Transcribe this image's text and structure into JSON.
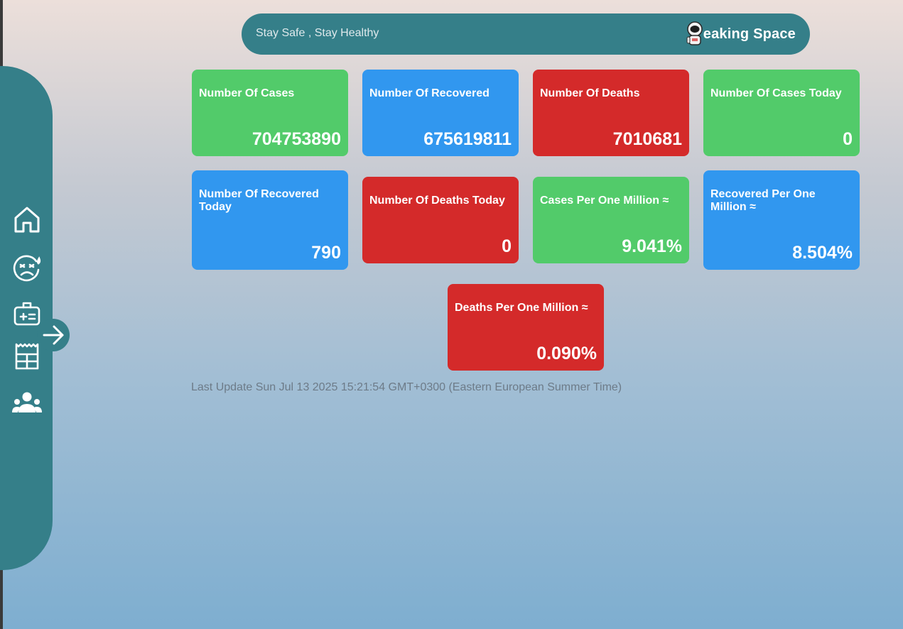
{
  "header": {
    "slogan": "Stay Safe , Stay Healthy",
    "brand": "eaking Space"
  },
  "sidebar": {
    "items": [
      {
        "icon": "home-icon"
      },
      {
        "icon": "sick-face-icon"
      },
      {
        "icon": "medical-kit-icon"
      },
      {
        "icon": "table-icon"
      },
      {
        "icon": "group-icon"
      }
    ],
    "toggle_icon": "arrow-right-icon"
  },
  "cards": [
    {
      "label": "Number Of Cases",
      "value": "704753890",
      "color": "#52cb6a"
    },
    {
      "label": "Number Of Recovered",
      "value": "675619811",
      "color": "#3197ef"
    },
    {
      "label": "Number Of Deaths",
      "value": "7010681",
      "color": "#d42a2a"
    },
    {
      "label": "Number Of Cases Today",
      "value": "0",
      "color": "#52cb6a"
    },
    {
      "label": "Number Of Recovered Today",
      "value": "790",
      "color": "#3197ef"
    },
    {
      "label": "Number Of Deaths Today",
      "value": "0",
      "color": "#d42a2a"
    },
    {
      "label": "Cases Per One Million ≈",
      "value": "9.041%",
      "color": "#52cb6a"
    },
    {
      "label": "Recovered Per One Million ≈",
      "value": "8.504%",
      "color": "#3197ef"
    },
    {
      "label": "Deaths Per One Million ≈",
      "value": "0.090%",
      "color": "#d42a2a"
    }
  ],
  "last_update": "Last Update Sun Jul 13 2025 15:21:54 GMT+0300 (Eastern European Summer Time)",
  "colors": {
    "accent": "#357f89",
    "green": "#52cb6a",
    "blue": "#3197ef",
    "red": "#d42a2a"
  }
}
